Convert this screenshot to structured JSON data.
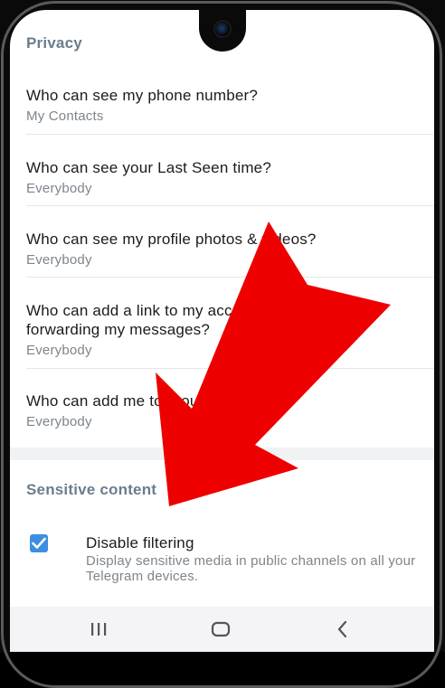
{
  "privacy": {
    "header": "Privacy",
    "items": [
      {
        "title": "Who can see my phone number?",
        "value": "My Contacts"
      },
      {
        "title": "Who can see your Last Seen time?",
        "value": "Everybody"
      },
      {
        "title": "Who can see my profile photos & videos?",
        "value": "Everybody"
      },
      {
        "title": "Who can add a link to my account when\nforwarding my messages?",
        "value": "Everybody"
      },
      {
        "title": "Who can add me to group chats?",
        "value": "Everybody"
      }
    ]
  },
  "sensitive": {
    "header": "Sensitive content",
    "toggle_title": "Disable filtering",
    "toggle_description": "Display sensitive media in public channels on all your Telegram devices.",
    "checked": true
  },
  "navbar": {
    "icons": [
      "recents-icon",
      "home-icon",
      "back-icon"
    ]
  },
  "colors": {
    "accent": "#3d8ee0",
    "arrow": "#ee0000",
    "header": "#6b7d8c"
  }
}
